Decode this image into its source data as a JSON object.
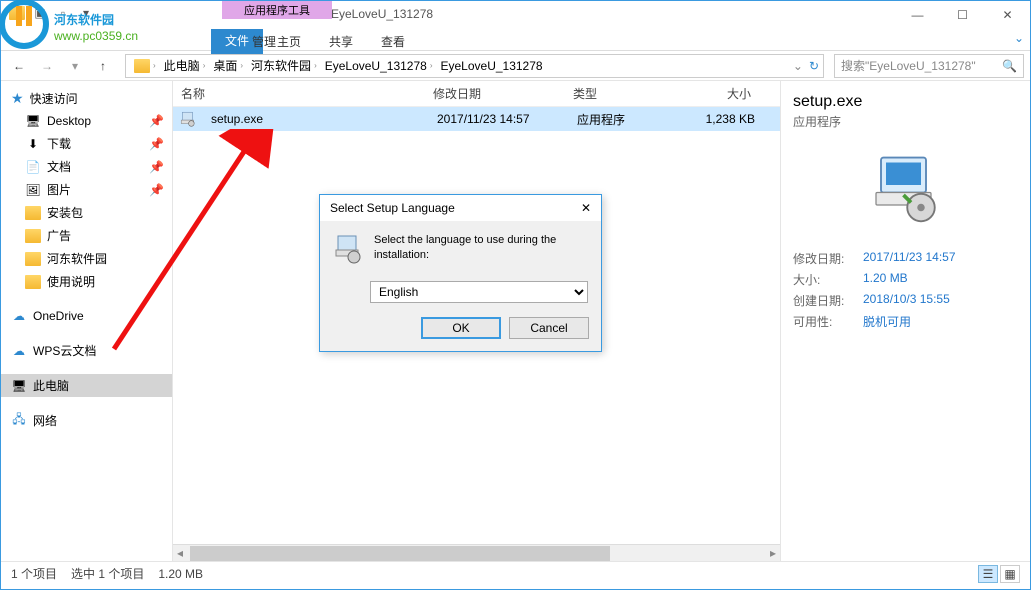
{
  "window": {
    "title": "EyeLoveU_131278",
    "ribbon_context": "应用程序工具",
    "tabs": {
      "file": "文件",
      "home": "主页",
      "share": "共享",
      "view": "查看",
      "manage": "管理"
    },
    "controls": {
      "min": "—",
      "max": "☐",
      "close": "✕"
    }
  },
  "watermark": {
    "line1": "河东软件园",
    "line2": "www.pc0359.cn"
  },
  "breadcrumb": {
    "items": [
      "此电脑",
      "桌面",
      "河东软件园",
      "EyeLoveU_131278",
      "EyeLoveU_131278"
    ]
  },
  "search": {
    "placeholder": "搜索\"EyeLoveU_131278\""
  },
  "sidebar": {
    "quick": "快速访问",
    "items": [
      "Desktop",
      "下载",
      "文档",
      "图片",
      "安装包",
      "广告",
      "河东软件园",
      "使用说明"
    ],
    "onedrive": "OneDrive",
    "wps": "WPS云文档",
    "thispc": "此电脑",
    "network": "网络"
  },
  "columns": {
    "name": "名称",
    "date": "修改日期",
    "type": "类型",
    "size": "大小"
  },
  "files": [
    {
      "name": "setup.exe",
      "date": "2017/11/23 14:57",
      "type": "应用程序",
      "size": "1,238 KB"
    }
  ],
  "details": {
    "title": "setup.exe",
    "type": "应用程序",
    "rows": [
      {
        "label": "修改日期:",
        "value": "2017/11/23 14:57"
      },
      {
        "label": "大小:",
        "value": "1.20 MB"
      },
      {
        "label": "创建日期:",
        "value": "2018/10/3 15:55"
      },
      {
        "label": "可用性:",
        "value": "脱机可用"
      }
    ]
  },
  "status": {
    "count": "1 个项目",
    "selected": "选中 1 个项目",
    "size": "1.20 MB"
  },
  "dialog": {
    "title": "Select Setup Language",
    "text": "Select the language to use during the installation:",
    "selected": "English",
    "ok": "OK",
    "cancel": "Cancel"
  }
}
